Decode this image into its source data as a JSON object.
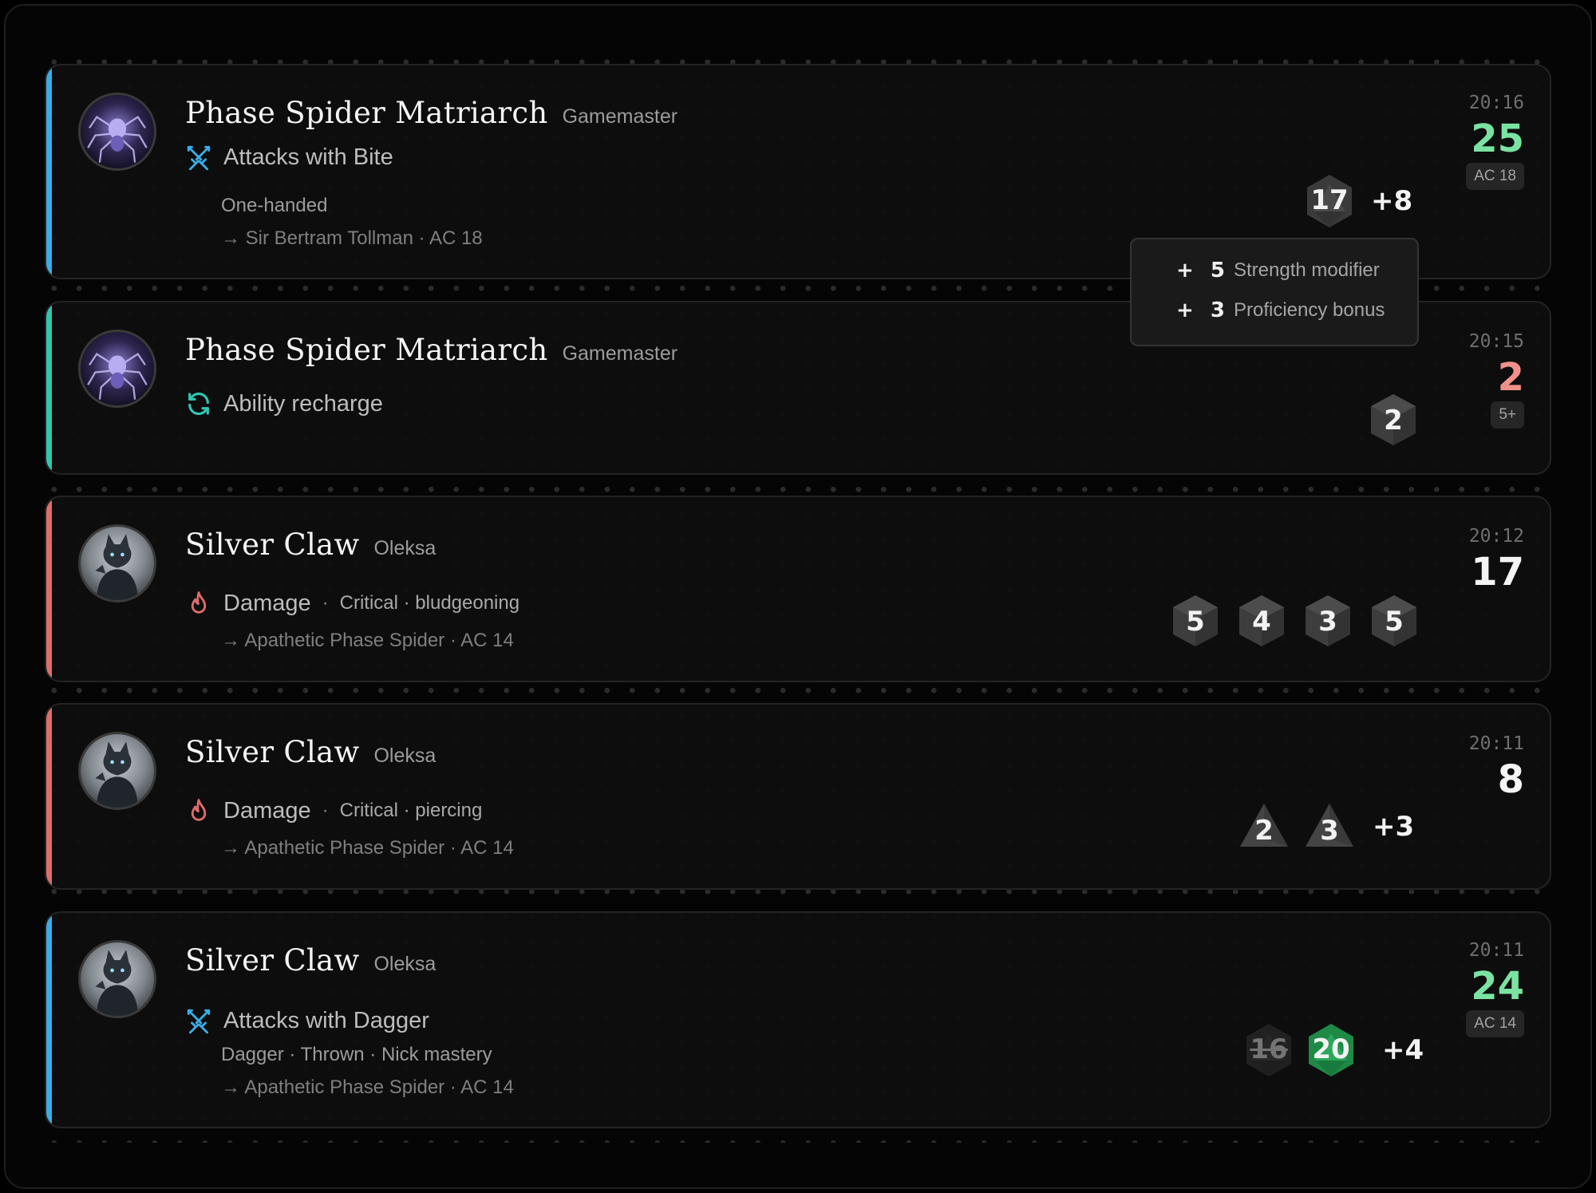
{
  "colors": {
    "attack": "#38aee6",
    "recharge": "#2fc7b0",
    "damage": "#e06c6c",
    "success": "#7be3a2",
    "fail": "#f0908a",
    "neutral": "#f4f4f4",
    "die_crit": "#1e8a46"
  },
  "tooltip": {
    "rows": [
      {
        "value": "+ 5",
        "label": "Strength modifier"
      },
      {
        "value": "+ 3",
        "label": "Proficiency bonus"
      }
    ]
  },
  "rolls": [
    {
      "name": "Phase Spider Matriarch",
      "owner": "Gamemaster",
      "avatar_icon": "spider-icon",
      "action_icon": "crossed-swords-icon",
      "action": "Attacks with Bite",
      "subtitle": "One-handed",
      "target": "→ Sir Bertram Tollman · AC 18",
      "time": "20:16",
      "total": "25",
      "badge": "AC 18",
      "dice": [
        "17"
      ],
      "modifier": "+8"
    },
    {
      "name": "Phase Spider Matriarch",
      "owner": "Gamemaster",
      "avatar_icon": "spider-icon",
      "action_icon": "recharge-icon",
      "action": "Ability recharge",
      "time": "20:15",
      "total": "2",
      "badge": "5+",
      "dice": [
        "2"
      ]
    },
    {
      "name": "Silver Claw",
      "owner": "Oleksa",
      "avatar_icon": "cat-icon",
      "action_icon": "flame-icon",
      "action": "Damage",
      "tags": "Critical · bludgeoning",
      "target": "→ Apathetic Phase Spider · AC 14",
      "time": "20:12",
      "total": "17",
      "dice": [
        "5",
        "4",
        "3",
        "5"
      ]
    },
    {
      "name": "Silver Claw",
      "owner": "Oleksa",
      "avatar_icon": "cat-icon",
      "action_icon": "flame-icon",
      "action": "Damage",
      "tags": "Critical · piercing",
      "target": "→ Apathetic Phase Spider · AC 14",
      "time": "20:11",
      "total": "8",
      "dice": [
        "2",
        "3"
      ],
      "modifier": "+3"
    },
    {
      "name": "Silver Claw",
      "owner": "Oleksa",
      "avatar_icon": "cat-icon",
      "action_icon": "crossed-swords-icon",
      "action": "Attacks with Dagger",
      "subtitle": "Dagger · Thrown · Nick mastery",
      "target": "→ Apathetic Phase Spider · AC 14",
      "time": "20:11",
      "total": "24",
      "badge": "AC 14",
      "dice": [
        "16",
        "20"
      ],
      "modifier": "+4"
    }
  ]
}
